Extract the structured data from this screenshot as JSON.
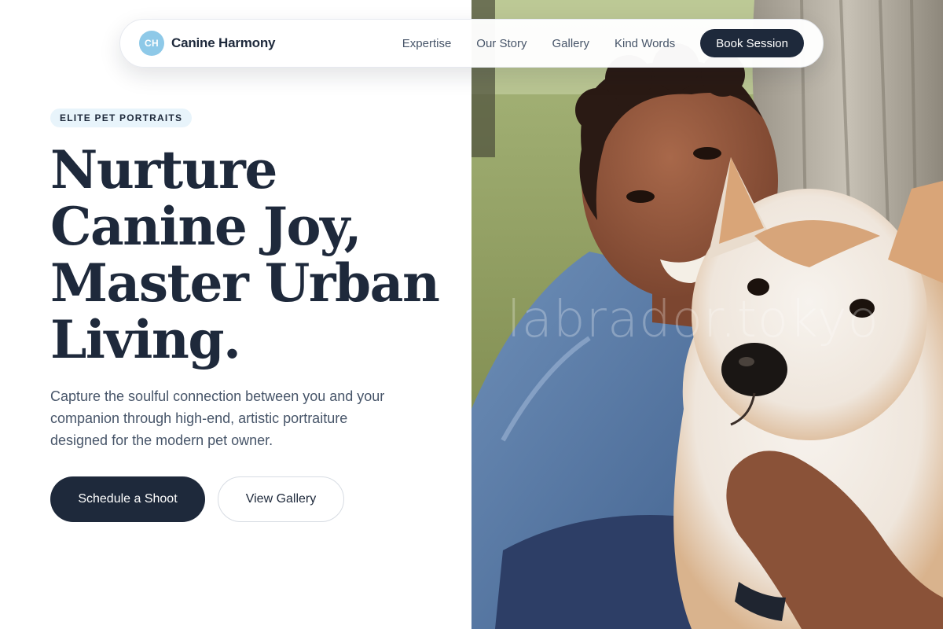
{
  "brand": {
    "initials": "CH",
    "name": "Canine Harmony"
  },
  "nav": {
    "links": [
      "Expertise",
      "Our Story",
      "Gallery",
      "Kind Words"
    ],
    "cta": "Book Session"
  },
  "hero": {
    "badge": "ELITE PET PORTRAITS",
    "headline": [
      "Nurture",
      "Canine Joy,",
      "Master Urban",
      "Living."
    ],
    "subtext": "Capture the soulful connection between you and your companion through high-end, artistic portraiture designed for the modern pet owner.",
    "primary_button": "Schedule a Shoot",
    "secondary_button": "View Gallery"
  },
  "photo": {
    "watermark": "labrador.tokyo",
    "icon": "hero-photo-woman-with-shiba-dog"
  },
  "colors": {
    "primary": "#1e293b",
    "accent": "#8ec9e8",
    "badge_bg": "#e8f4fb",
    "muted_text": "#475569"
  }
}
